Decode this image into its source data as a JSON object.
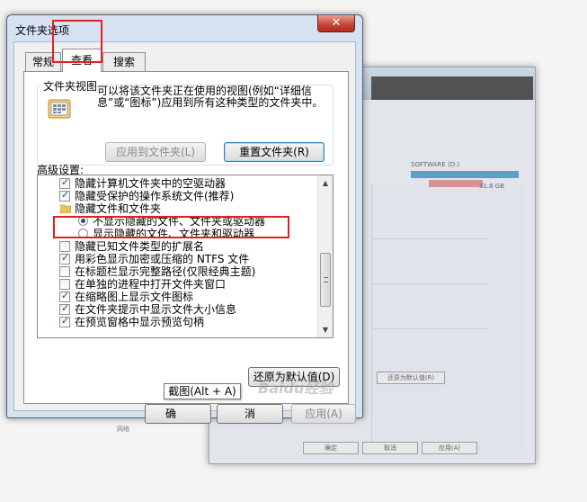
{
  "background_window": {
    "drive_label": "SOFTWARE (D:)",
    "drive_free": "31.8 GB",
    "restore_button": "还原为默认值(R)",
    "ok_button": "确定",
    "cancel_button": "取消",
    "apply_button": "应用(A)",
    "network_label": "网络"
  },
  "dialog": {
    "title": "文件夹选项",
    "close_glyph": "✕",
    "tabs": [
      {
        "label": "常规"
      },
      {
        "label": "查看",
        "selected": true
      },
      {
        "label": "搜索"
      }
    ],
    "folder_views": {
      "group_label": "文件夹视图",
      "description": "可以将该文件夹正在使用的视图(例如“详细信息”或“图标”)应用到所有这种类型的文件夹中。",
      "apply_button": "应用到文件夹(L)",
      "apply_enabled": false,
      "reset_button": "重置文件夹(R)"
    },
    "advanced": {
      "label": "高级设置:",
      "items": [
        {
          "type": "checkbox",
          "label": "隐藏计算机文件夹中的空驱动器",
          "checked": true
        },
        {
          "type": "checkbox",
          "label": "隐藏受保护的操作系统文件(推荐)",
          "checked": true
        },
        {
          "type": "folder",
          "label": "隐藏文件和文件夹"
        },
        {
          "type": "radio",
          "label": "不显示隐藏的文件、文件夹或驱动器",
          "checked": true
        },
        {
          "type": "radio",
          "label": "显示隐藏的文件、文件夹和驱动器",
          "checked": false
        },
        {
          "type": "checkbox",
          "label": "隐藏已知文件类型的扩展名",
          "checked": false
        },
        {
          "type": "checkbox",
          "label": "用彩色显示加密或压缩的 NTFS 文件",
          "checked": true
        },
        {
          "type": "checkbox",
          "label": "在标题栏显示完整路径(仅限经典主题)",
          "checked": false
        },
        {
          "type": "checkbox",
          "label": "在单独的进程中打开文件夹窗口",
          "checked": false
        },
        {
          "type": "checkbox",
          "label": "在缩略图上显示文件图标",
          "checked": true
        },
        {
          "type": "checkbox",
          "label": "在文件夹提示中显示文件大小信息",
          "checked": true
        },
        {
          "type": "checkbox",
          "label": "在预览窗格中显示预览句柄",
          "checked": true
        }
      ]
    },
    "restore_defaults_button": "还原为默认值(D)",
    "ok_button": "确",
    "cancel_button": "消",
    "apply_button": "应用(A)",
    "apply_enabled": false,
    "tooltip": "截图(Alt + A)",
    "watermark": "Baidu经验",
    "highlight_color": "#e31f26"
  }
}
